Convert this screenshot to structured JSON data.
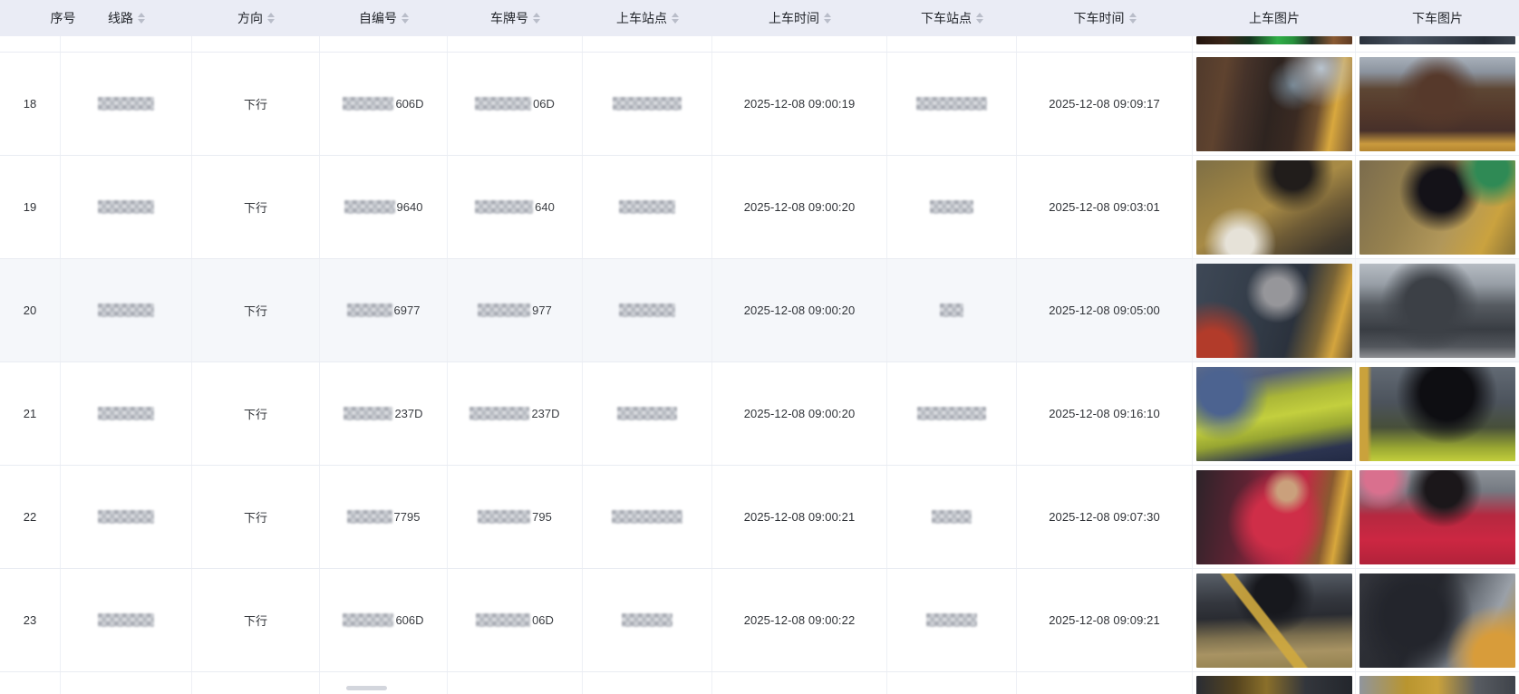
{
  "colors": {
    "header_bg": "#eaecf5",
    "hover_row_bg": "#f5f7fa",
    "row_border": "#e9ecf2",
    "sort_caret": "#b9bdc9",
    "hivis_yellow": "#c3cf3e",
    "bus_rail_yellow": "#d4a53e"
  },
  "table": {
    "columns": [
      {
        "id": "seq",
        "label": "序号",
        "sortable": false
      },
      {
        "id": "line",
        "label": "线路",
        "sortable": true
      },
      {
        "id": "direction",
        "label": "方向",
        "sortable": true
      },
      {
        "id": "unit",
        "label": "自编号",
        "sortable": true
      },
      {
        "id": "plate",
        "label": "车牌号",
        "sortable": true
      },
      {
        "id": "board_station",
        "label": "上车站点",
        "sortable": true
      },
      {
        "id": "board_time",
        "label": "上车时间",
        "sortable": true
      },
      {
        "id": "alight_station",
        "label": "下车站点",
        "sortable": true
      },
      {
        "id": "alight_time",
        "label": "下车时间",
        "sortable": true
      },
      {
        "id": "board_photo",
        "label": "上车图片",
        "sortable": false
      },
      {
        "id": "alight_photo",
        "label": "下车图片",
        "sortable": false
      }
    ],
    "partial_top_row": {
      "photos": {
        "board": "r17-board",
        "alight": "r17-alight"
      }
    },
    "rows": [
      {
        "seq": "18",
        "direction": "下行",
        "unit_suffix": "606D",
        "plate_suffix": "06D",
        "board_time": "2025-12-08 09:00:19",
        "alight_time": "2025-12-08 09:09:17",
        "masks": {
          "line": 62,
          "unit": 56,
          "plate": 62,
          "board_station": 76,
          "alight_station": 78
        },
        "photos": {
          "board": "r18-board",
          "alight": "r18-alight"
        },
        "highlighted": false
      },
      {
        "seq": "19",
        "direction": "下行",
        "unit_suffix": "9640",
        "plate_suffix": "640",
        "board_time": "2025-12-08 09:00:20",
        "alight_time": "2025-12-08 09:03:01",
        "masks": {
          "line": 62,
          "unit": 56,
          "plate": 64,
          "board_station": 62,
          "alight_station": 48
        },
        "photos": {
          "board": "r19-board",
          "alight": "r19-alight"
        },
        "highlighted": false
      },
      {
        "seq": "20",
        "direction": "下行",
        "unit_suffix": "6977",
        "plate_suffix": "977",
        "board_time": "2025-12-08 09:00:20",
        "alight_time": "2025-12-08 09:05:00",
        "masks": {
          "line": 62,
          "unit": 50,
          "plate": 58,
          "board_station": 62,
          "alight_station": 26
        },
        "photos": {
          "board": "r20-board",
          "alight": "r20-alight"
        },
        "highlighted": true
      },
      {
        "seq": "21",
        "direction": "下行",
        "unit_suffix": "237D",
        "plate_suffix": "237D",
        "board_time": "2025-12-08 09:00:20",
        "alight_time": "2025-12-08 09:16:10",
        "masks": {
          "line": 62,
          "unit": 54,
          "plate": 66,
          "board_station": 66,
          "alight_station": 76
        },
        "photos": {
          "board": "r21-board",
          "alight": "r21-alight"
        },
        "highlighted": false
      },
      {
        "seq": "22",
        "direction": "下行",
        "unit_suffix": "7795",
        "plate_suffix": "795",
        "board_time": "2025-12-08 09:00:21",
        "alight_time": "2025-12-08 09:07:30",
        "masks": {
          "line": 62,
          "unit": 50,
          "plate": 58,
          "board_station": 78,
          "alight_station": 44
        },
        "photos": {
          "board": "r22-board",
          "alight": "r22-alight"
        },
        "highlighted": false
      },
      {
        "seq": "23",
        "direction": "下行",
        "unit_suffix": "606D",
        "plate_suffix": "06D",
        "board_time": "2025-12-08 09:00:22",
        "alight_time": "2025-12-08 09:09:21",
        "masks": {
          "line": 62,
          "unit": 56,
          "plate": 60,
          "board_station": 56,
          "alight_station": 56
        },
        "photos": {
          "board": "r23-board",
          "alight": "r23-alight"
        },
        "highlighted": false
      }
    ],
    "partial_bottom_row": {
      "photos": {
        "board": "r24-board",
        "alight": "r24-alight"
      }
    }
  }
}
